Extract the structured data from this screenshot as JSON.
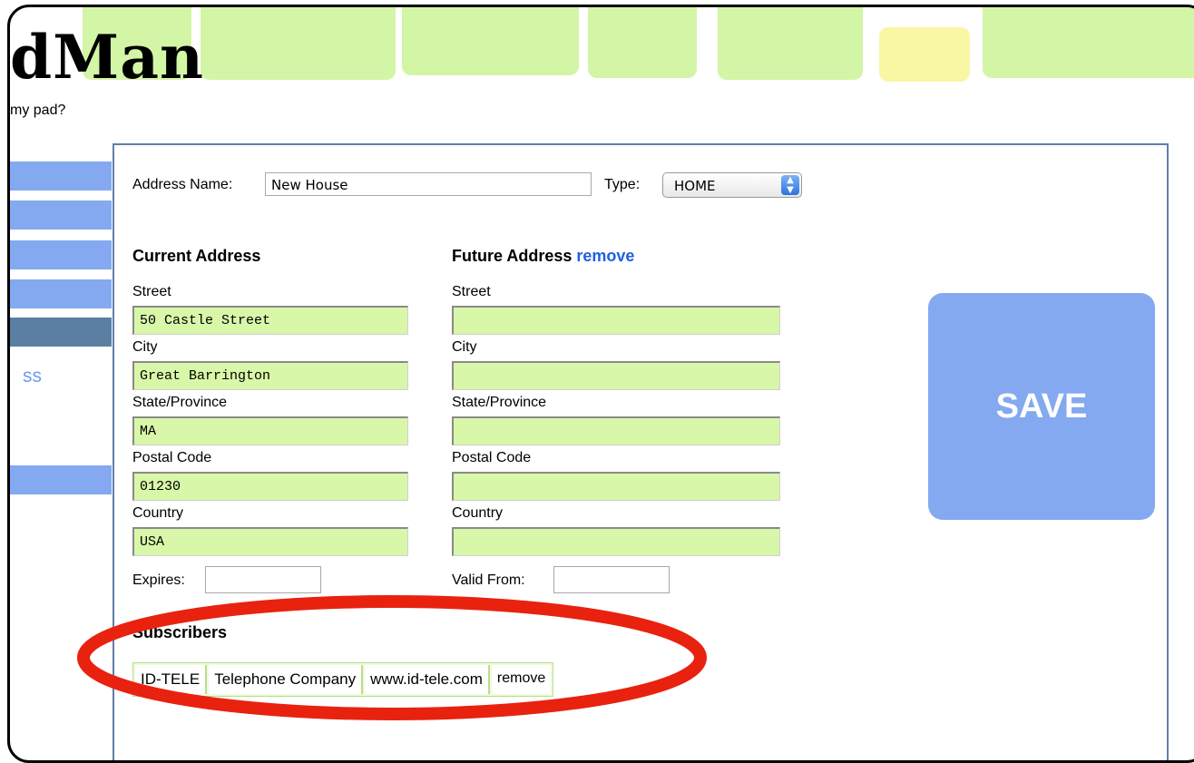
{
  "header": {
    "logo_text": "dMan",
    "tagline": "my pad?"
  },
  "sidebar": {
    "partial_label": "ss"
  },
  "form": {
    "address_name_label": "Address Name:",
    "address_name_value": "New House",
    "type_label": "Type:",
    "type_value": "HOME",
    "current": {
      "heading": "Current Address",
      "street_label": "Street",
      "street": "50 Castle Street",
      "city_label": "City",
      "city": "Great Barrington",
      "state_label": "State/Province",
      "state": "MA",
      "postal_label": "Postal Code",
      "postal": "01230",
      "country_label": "Country",
      "country": "USA",
      "expires_label": "Expires:",
      "expires": ""
    },
    "future": {
      "heading": "Future Address",
      "remove_label": "remove",
      "street_label": "Street",
      "street": "",
      "city_label": "City",
      "city": "",
      "state_label": "State/Province",
      "state": "",
      "postal_label": "Postal Code",
      "postal": "",
      "country_label": "Country",
      "country": "",
      "valid_from_label": "Valid From:",
      "valid_from": ""
    },
    "save_label": "SAVE"
  },
  "subscribers": {
    "heading": "Subscribers",
    "rows": [
      {
        "code": "ID-TELE",
        "name": "Telephone Company",
        "url": "www.id-tele.com",
        "remove": "remove"
      }
    ]
  },
  "colors": {
    "tile_green": "#d3f5a6",
    "tile_yellow": "#f9f7a4",
    "accent_blue": "#84a9f0",
    "input_green": "#d8f7a8",
    "annotation_red": "#e8220f"
  }
}
